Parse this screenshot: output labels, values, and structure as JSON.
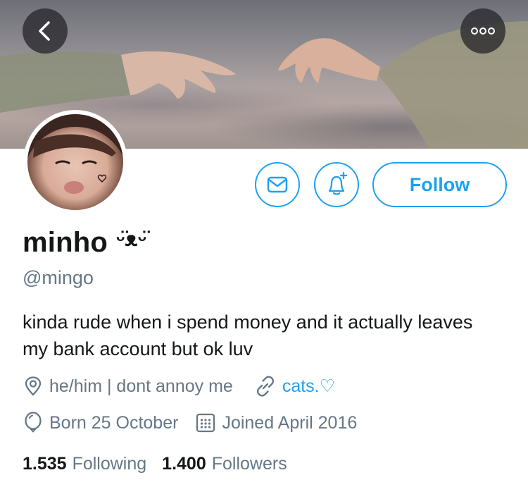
{
  "profile": {
    "name": "minho",
    "name_decoration": "ᵕ̈ᴥᵕ̈",
    "handle": "@mingo",
    "bio": "kinda rude when i spend money and it actually leaves my bank account but ok luv",
    "location": "he/him | dont annoy me",
    "website": "cats.♡",
    "birthday": "Born 25 October",
    "joined": "Joined April 2016"
  },
  "actions": {
    "follow_label": "Follow"
  },
  "stats": {
    "following_count": "1.535",
    "following_label": "Following",
    "followers_count": "1.400",
    "followers_label": "Followers"
  },
  "icons": {
    "back": "chevron-left-icon",
    "more": "more-dots-icon",
    "message": "envelope-icon",
    "notify": "bell-plus-icon",
    "location": "location-pin-icon",
    "link": "link-icon",
    "birthday": "balloon-icon",
    "joined": "calendar-icon"
  },
  "colors": {
    "accent": "#1da1f2",
    "secondary_text": "#657786",
    "primary_text": "#14171a"
  }
}
